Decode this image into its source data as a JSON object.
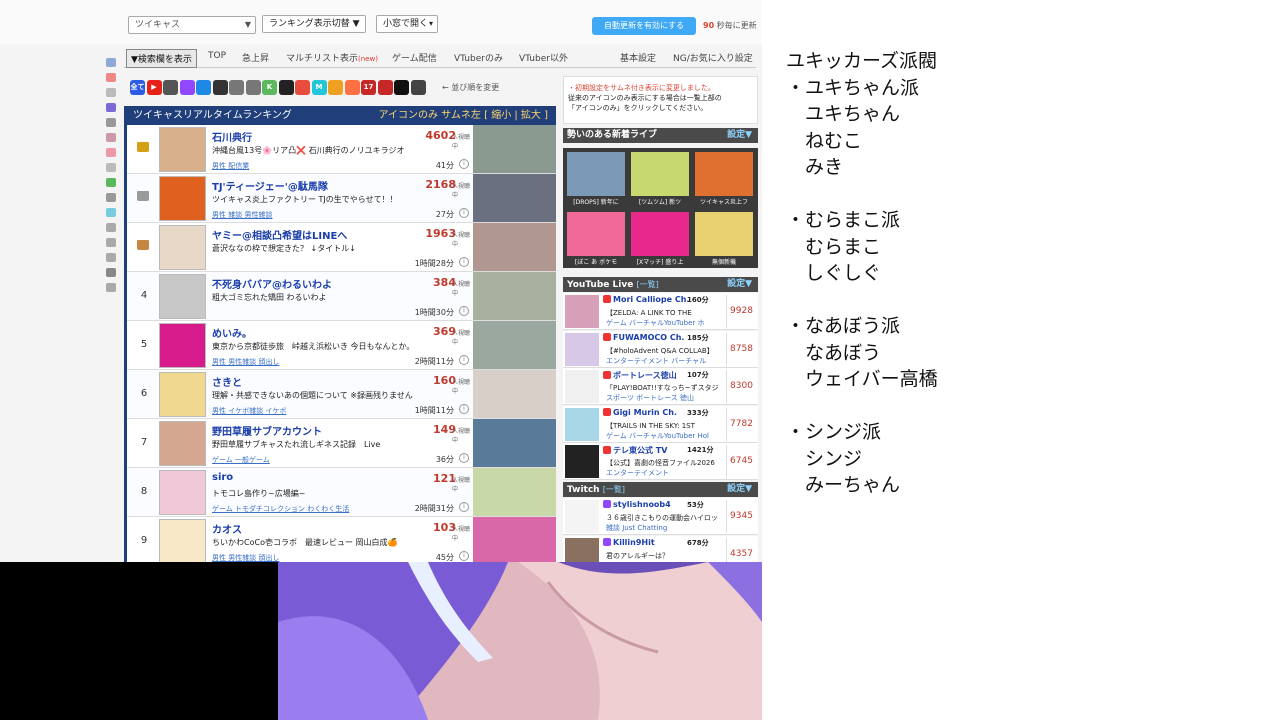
{
  "toolbar": {
    "site_select": "ツイキャス",
    "ranking_toggle": "ランキング表示切替 ▼",
    "window_select": "小窓で開く",
    "auto_update_button": "自動更新を有効にする",
    "update_seconds": "90",
    "update_suffix": "秒毎に更新"
  },
  "nav": {
    "search_button": "▼検索欄を表示",
    "items": [
      "TOP",
      "急上昇",
      "マルチリスト表示",
      "ゲーム配信",
      "VTuberのみ",
      "VTuber以外",
      "基本設定",
      "NG/お気に入り設定"
    ],
    "new_badge": "(new)"
  },
  "icons": {
    "sort_text": "← 並び順を変更",
    "services": [
      "all",
      "youtube",
      "openrec",
      "twitch",
      "niconico",
      "mildom",
      "17live",
      "tiktok",
      "other"
    ],
    "colors": [
      "#2b5ce6",
      "#e62117",
      "#555555",
      "#9146ff",
      "#1e88e5",
      "#333333",
      "#777777",
      "#777777",
      "#5cb85c",
      "#222222",
      "#e74c3c",
      "#26c6da",
      "#f0a020",
      "#ff7043",
      "#c62828",
      "#c62828",
      "#111111",
      "#444444"
    ],
    "labels": [
      "全て",
      "▶",
      "",
      "",
      "",
      "",
      "",
      "",
      "K",
      "",
      "",
      "M",
      "",
      "",
      "17",
      "",
      "",
      ""
    ]
  },
  "ranking": {
    "title": "ツイキャスリアルタイムランキング",
    "header_links": "アイコンのみ サムネ左 [ 縮小 | 拡大 ]",
    "viewers_unit": "人視聴中",
    "rows": [
      {
        "rank": "1",
        "name": "石川典行",
        "viewers": "4602",
        "title": "沖縄台風13号🌸リア凸❌ 石川典行のノリユキラジオ",
        "tags": "男性 配信業",
        "duration": "41分"
      },
      {
        "rank": "2",
        "name": "TJ'ティージェー'@駄馬隊",
        "viewers": "2168",
        "title": "ツイキャス炎上ファクトリー TJの生でやらせて！！",
        "tags": "男性 雑談 男性雑談",
        "duration": "27分"
      },
      {
        "rank": "3",
        "name": "ヤミー@相談凸希望はLINEへ",
        "viewers": "1963",
        "title": "蒼沢ななの枠で想定きた？ ↓タイトル↓",
        "tags": "",
        "duration": "1時間28分"
      },
      {
        "rank": "4",
        "name": "不死身ババア@わるいわよ",
        "viewers": "384",
        "title": "粗大ゴミ忘れた矯田 わるいわよ",
        "tags": "",
        "duration": "1時間30分"
      },
      {
        "rank": "5",
        "name": "めいみ。",
        "viewers": "369",
        "title": "東京から京都徒歩旅　峠越え浜松いき 今日もなんとか。",
        "tags": "男性 男性雑談 顔出し",
        "duration": "2時間11分"
      },
      {
        "rank": "6",
        "name": "さきと",
        "viewers": "160",
        "title": "理解・共感できないあの個題について ※録画残りません",
        "tags": "男性 イケボ雑談 イケボ",
        "duration": "1時間11分"
      },
      {
        "rank": "7",
        "name": "野田草履サブアカウント",
        "viewers": "149",
        "title": "野田草履サブキャスたれ流しギネス記録　Live",
        "tags": "ゲーム 一般ゲーム",
        "duration": "36分"
      },
      {
        "rank": "8",
        "name": "siro",
        "viewers": "121",
        "title": "トモコレ島作り~広場編~",
        "tags": "ゲーム トモダチコレクション わくわく生活",
        "duration": "2時間31分"
      },
      {
        "rank": "9",
        "name": "カオス",
        "viewers": "103",
        "title": "ちいかわCoCo壱コラボ　最速レビュー 岡山白成🍊",
        "tags": "男性 男性雑談 顔出し",
        "duration": "45分"
      }
    ]
  },
  "notice": {
    "line1": "・初期設定をサムネ付き表示に変更しました。",
    "line2": "従来のアイコンのみ表示にする場合は一覧上部の",
    "line3": "「アイコンのみ」をクリックしてください。"
  },
  "hot": {
    "title": "勢いのある新着ライブ",
    "settings": "設定▼",
    "items": [
      "[DROPS] 新年に",
      "[ツムツム] 新ツ",
      "ツイキャス炎上フ",
      "[ぼこ あ ボケモ",
      "[Xマッチ] 盛り上",
      "無個新機"
    ]
  },
  "youtube": {
    "title": "YouTube Live",
    "list_link": "[一覧]",
    "settings": "設定▼",
    "rows": [
      {
        "name": "Mori Calliope Ch.",
        "minutes": "160分",
        "title": "【ZELDA: A LINK TO THE",
        "tags": "ゲーム バーチャルYouTuber ホ",
        "viewers": "9928"
      },
      {
        "name": "FUWAMOCO Ch.",
        "minutes": "185分",
        "title": "【#holoAdvent Q&A COLLAB】",
        "tags": "エンターテイメント バーチャル",
        "viewers": "8758"
      },
      {
        "name": "ボートレース徳山",
        "minutes": "107分",
        "title": "「PLAY!BOAT!!すなっち~ずスタジ",
        "tags": "スポーツ ボートレース 徳山",
        "viewers": "8300"
      },
      {
        "name": "Gigi Murin Ch.",
        "minutes": "333分",
        "title": "【TRAILS IN THE SKY: 1ST",
        "tags": "ゲーム バーチャルYouTuber Hol",
        "viewers": "7782"
      },
      {
        "name": "テレ東公式 TV",
        "minutes": "1421分",
        "title": "【公式】喜劇の怪音ファイル2026",
        "tags": "エンターテイメント",
        "viewers": "6745"
      }
    ]
  },
  "twitch": {
    "title": "Twitch",
    "list_link": "[一覧]",
    "settings": "設定▼",
    "rows": [
      {
        "name": "stylishnoob4",
        "minutes": "53分",
        "title": "３６歳引きこもりの運動会ハイロッ",
        "tags": "雑談 Just Chatting",
        "viewers": "9345"
      },
      {
        "name": "Killin9Hit",
        "minutes": "678分",
        "title": "君のアレルギーは？",
        "tags": "",
        "viewers": "4357"
      }
    ]
  },
  "overlay": {
    "lines": [
      "ユキッカーズ派閥",
      "・ユキちゃん派",
      "　ユキちゃん",
      "　ねむこ",
      "　みき",
      "",
      "・むらまこ派",
      "　むらまこ",
      "　しぐしぐ",
      "",
      "・なあぼう派",
      "　なあぼう",
      "　ウェイバー高橋",
      "",
      "・シンジ派",
      "　シンジ",
      "　みーちゃん"
    ]
  }
}
